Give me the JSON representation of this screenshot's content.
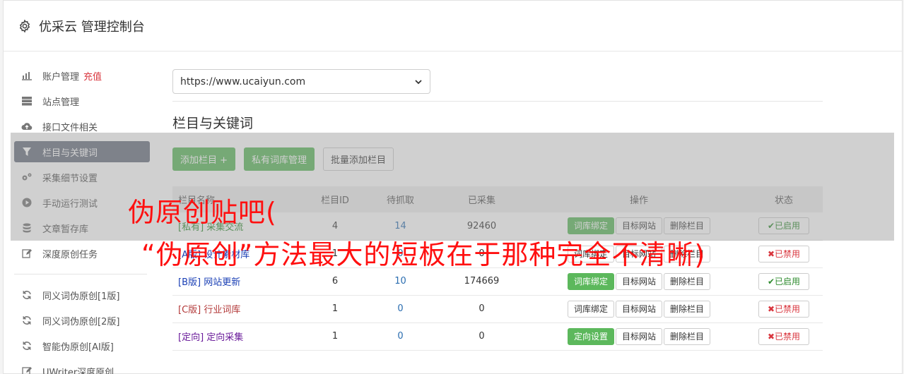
{
  "header": {
    "title": "优采云 管理控制台",
    "icon": "gear-icon"
  },
  "sidebar": {
    "items": [
      {
        "label": "账户管理",
        "extra": "充值",
        "icon": "bar-chart-icon"
      },
      {
        "label": "站点管理",
        "icon": "server-icon"
      },
      {
        "label": "接口文件相关",
        "icon": "cloud-upload-icon"
      },
      {
        "label": "栏目与关键词",
        "icon": "filter-icon",
        "active": true
      },
      {
        "label": "采集细节设置",
        "icon": "cogs-icon"
      },
      {
        "label": "手动运行测试",
        "icon": "play-circle-icon"
      },
      {
        "label": "文章暂存库",
        "icon": "database-icon"
      },
      {
        "label": "深度原创任务",
        "icon": "edit-icon"
      }
    ],
    "items2": [
      {
        "label": "同义词伪原创[1版]",
        "icon": "refresh-icon"
      },
      {
        "label": "同义词伪原创[2版]",
        "icon": "refresh-icon"
      },
      {
        "label": "智能伪原创[AI版]",
        "icon": "refresh-icon"
      },
      {
        "label": "UWriter深度原创",
        "icon": "edit-icon"
      }
    ]
  },
  "site_select": {
    "value": "https://www.ucaiyun.com"
  },
  "section": {
    "title": "栏目与关键词"
  },
  "actions": {
    "add": "添加栏目 +",
    "private": "私有词库管理",
    "batch": "批量添加栏目"
  },
  "table": {
    "headers": {
      "name": "栏目名称",
      "id": "栏目ID",
      "pending": "待抓取",
      "collected": "已采集",
      "ops": "操作",
      "status": "状态"
    },
    "rows": [
      {
        "tag": "[私有]",
        "name": "采集交流",
        "id": "4",
        "pending": "14",
        "collected": "92460",
        "op1": "词库绑定",
        "op2": "目标网站",
        "op3": "删除栏目",
        "status": "✔已启用",
        "tag_color": "green",
        "op1_green": true,
        "on": true
      },
      {
        "tag": "[A版]",
        "name": "设计素材库",
        "id": "1",
        "pending": "0",
        "collected": "0",
        "op1": "词库绑定",
        "op2": "目标网站",
        "op3": "删除栏目",
        "status": "✖已禁用",
        "tag_color": "blue",
        "op1_green": false,
        "on": false
      },
      {
        "tag": "[B版]",
        "name": "网站更新",
        "id": "6",
        "pending": "10",
        "collected": "174669",
        "op1": "词库绑定",
        "op2": "目标网站",
        "op3": "删除栏目",
        "status": "✔已启用",
        "tag_color": "blue",
        "op1_green": true,
        "on": true
      },
      {
        "tag": "[C版]",
        "name": "行业词库",
        "id": "1",
        "pending": "0",
        "collected": "0",
        "op1": "词库绑定",
        "op2": "目标网站",
        "op3": "删除栏目",
        "status": "✖已禁用",
        "tag_color": "red",
        "op1_green": false,
        "on": false
      },
      {
        "tag": "[定向]",
        "name": "定向采集",
        "id": "1",
        "pending": "0",
        "collected": "0",
        "op1": "定向设置",
        "op2": "目标网站",
        "op3": "删除栏目",
        "status": "✖已禁用",
        "tag_color": "purple",
        "op1_green": true,
        "on": false
      }
    ]
  },
  "overlay": {
    "line1": "伪原创贴吧(",
    "line2": "“伪原创”方法最大的短板在于那种完全不清晰)"
  }
}
